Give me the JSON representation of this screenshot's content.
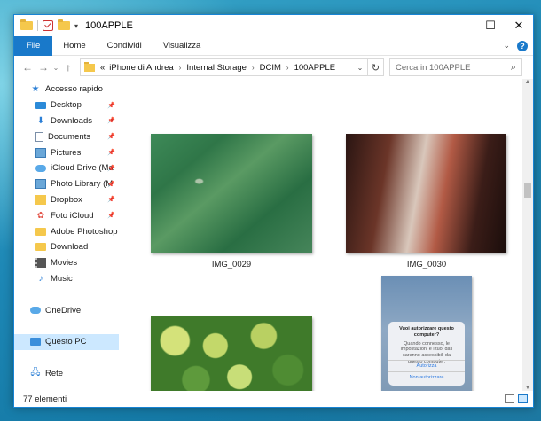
{
  "window": {
    "title": "100APPLE",
    "controls": {
      "minimize": "—",
      "maximize": "☐",
      "close": "✕"
    }
  },
  "ribbon": {
    "tabs": [
      "File",
      "Home",
      "Condividi",
      "Visualizza"
    ],
    "collapse": "⌄",
    "help": "?"
  },
  "address": {
    "overflow": "«",
    "crumbs": [
      "iPhone di Andrea",
      "Internal Storage",
      "DCIM",
      "100APPLE"
    ],
    "search_placeholder": "Cerca in 100APPLE"
  },
  "navpane": {
    "items": [
      {
        "label": "Accesso rapido",
        "icon": "star-icon",
        "level": 0,
        "pinned": false
      },
      {
        "label": "Desktop",
        "icon": "desktop-icon",
        "level": 1,
        "pinned": true
      },
      {
        "label": "Downloads",
        "icon": "download-icon",
        "level": 1,
        "pinned": true
      },
      {
        "label": "Documents",
        "icon": "document-icon",
        "level": 1,
        "pinned": true
      },
      {
        "label": "Pictures",
        "icon": "pictures-icon",
        "level": 1,
        "pinned": true
      },
      {
        "label": "iCloud Drive (Ma",
        "icon": "cloud-icon",
        "level": 1,
        "pinned": true
      },
      {
        "label": "Photo Library (M",
        "icon": "pictures-icon",
        "level": 1,
        "pinned": true
      },
      {
        "label": "Dropbox",
        "icon": "dropbox-icon",
        "level": 1,
        "pinned": true
      },
      {
        "label": "Foto iCloud",
        "icon": "photos-icon",
        "level": 1,
        "pinned": true
      },
      {
        "label": "Adobe Photoshop C",
        "icon": "folder-icon",
        "level": 1,
        "pinned": false
      },
      {
        "label": "Download",
        "icon": "folder-icon",
        "level": 1,
        "pinned": false
      },
      {
        "label": "Movies",
        "icon": "film-icon",
        "level": 1,
        "pinned": false
      },
      {
        "label": "Music",
        "icon": "music-icon",
        "level": 1,
        "pinned": false
      },
      {
        "label": "",
        "icon": "",
        "level": 0,
        "pinned": false
      },
      {
        "label": "OneDrive",
        "icon": "onedrive-icon",
        "level": 0,
        "pinned": false
      },
      {
        "label": "",
        "icon": "",
        "level": 0,
        "pinned": false
      },
      {
        "label": "Questo PC",
        "icon": "pc-icon",
        "level": 0,
        "pinned": false,
        "selected": true
      },
      {
        "label": "",
        "icon": "",
        "level": 0,
        "pinned": false
      },
      {
        "label": "Rete",
        "icon": "network-icon",
        "level": 0,
        "pinned": false
      }
    ]
  },
  "files": [
    {
      "name": "IMG_0029",
      "kind": "river"
    },
    {
      "name": "IMG_0030",
      "kind": "canyon"
    },
    {
      "name": "",
      "kind": "fruit"
    },
    {
      "name": "",
      "kind": "phone"
    }
  ],
  "phone_dialog": {
    "title": "Vuoi autorizzare questo computer?",
    "message": "Quando connesso, le impostazioni e i tuoi dati saranno accessibili da questo computer.",
    "allow": "Autorizza",
    "deny": "Non autorizzare"
  },
  "status": {
    "count": "77 elementi"
  },
  "colors": {
    "accent": "#1979ca",
    "selected": "#cce8ff"
  }
}
